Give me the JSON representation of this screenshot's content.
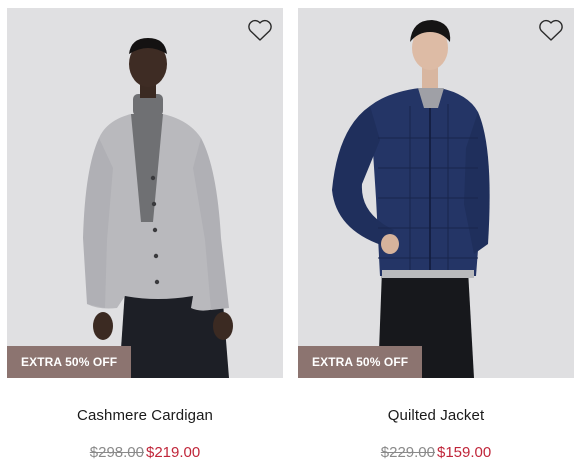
{
  "products": [
    {
      "name": "Cashmere Cardigan",
      "badge": "EXTRA 50% OFF",
      "original_price": "$298.00",
      "sale_price": "$219.00",
      "wishlist_icon": "heart-outline-icon"
    },
    {
      "name": "Quilted Jacket",
      "badge": "EXTRA 50% OFF",
      "original_price": "$229.00",
      "sale_price": "$159.00",
      "wishlist_icon": "heart-outline-icon"
    }
  ],
  "colors": {
    "badge_bg": "#8c7470",
    "sale_price": "#c0263a",
    "original_price": "#8a8a8a"
  }
}
